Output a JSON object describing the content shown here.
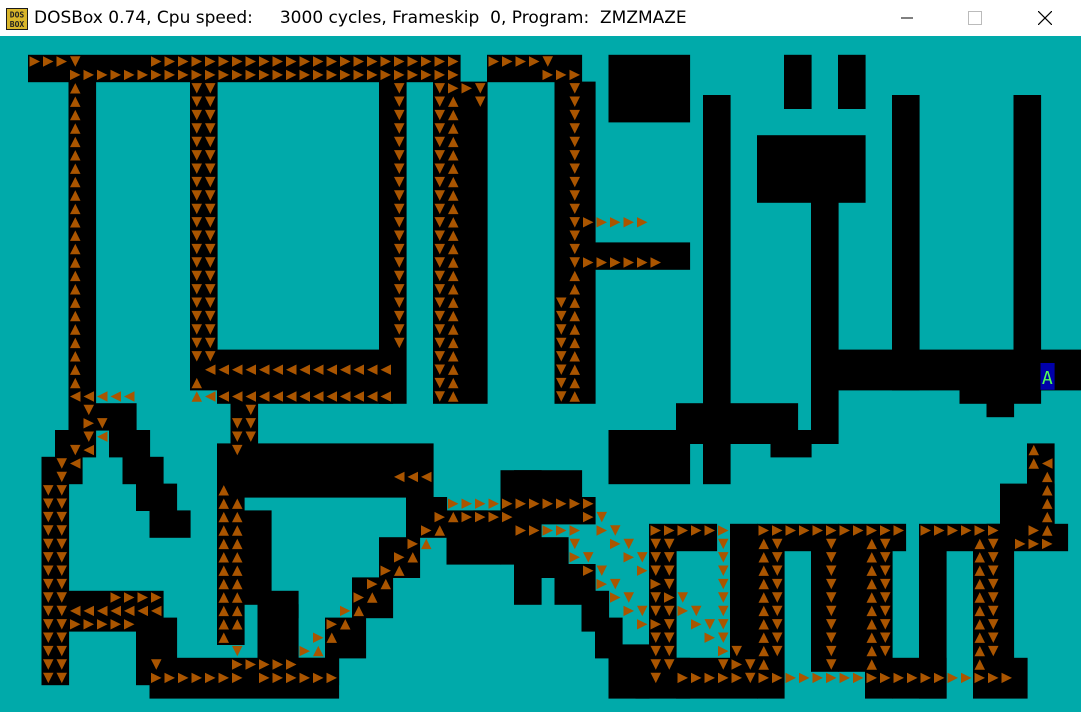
{
  "window": {
    "title": "DOSBox 0.74, Cpu speed:     3000 cycles, Frameskip  0, Program:  ZMZMAZE",
    "icon": {
      "name": "dosbox-icon",
      "line1": "DOS",
      "line2": "BOX"
    },
    "controls": {
      "minimize": "minimize-icon",
      "maximize": "maximize-icon",
      "close": "close-icon"
    }
  },
  "screen": {
    "program": "ZMZMAZE",
    "player_glyph": "A",
    "colors": {
      "background": "#00aaaa",
      "wall": "#000000",
      "arrow": "#aa5500",
      "player_bg": "#0000aa",
      "player_fg": "#55ff55"
    }
  }
}
